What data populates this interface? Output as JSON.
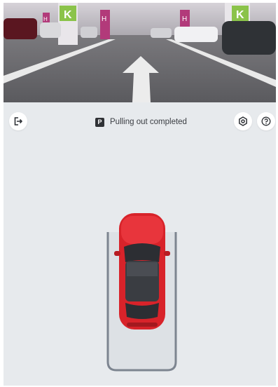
{
  "status": {
    "parking_badge": "P",
    "message": "Pulling out completed"
  },
  "camera": {
    "signs": [
      "K",
      "H",
      "H",
      "K",
      "H"
    ],
    "arrow_direction": "forward"
  },
  "icons": {
    "exit": "exit-icon",
    "settings": "gear-icon",
    "help": "help-icon"
  },
  "colors": {
    "car_body": "#d8232a",
    "panel_bg": "#e7eaed",
    "slot_line": "#7d8590"
  }
}
